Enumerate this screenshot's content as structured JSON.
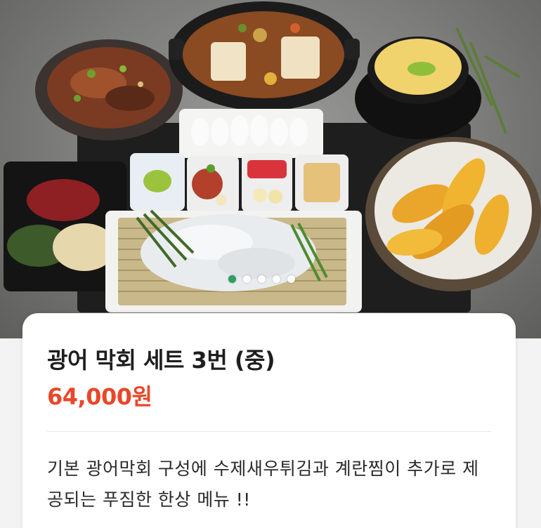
{
  "product": {
    "title": "광어 막회 세트 3번 (중)",
    "price": "64,000원",
    "description": "기본 광어막회 구성에 수제새우튀김과 계란찜이 추가로 제공되는 푸짐한 한상 메뉴 !!"
  },
  "carousel": {
    "total": 5,
    "active_index": 0
  },
  "colors": {
    "price": "#e8472a",
    "active_dot": "#2f9e64",
    "card_background": "#ffffff"
  }
}
